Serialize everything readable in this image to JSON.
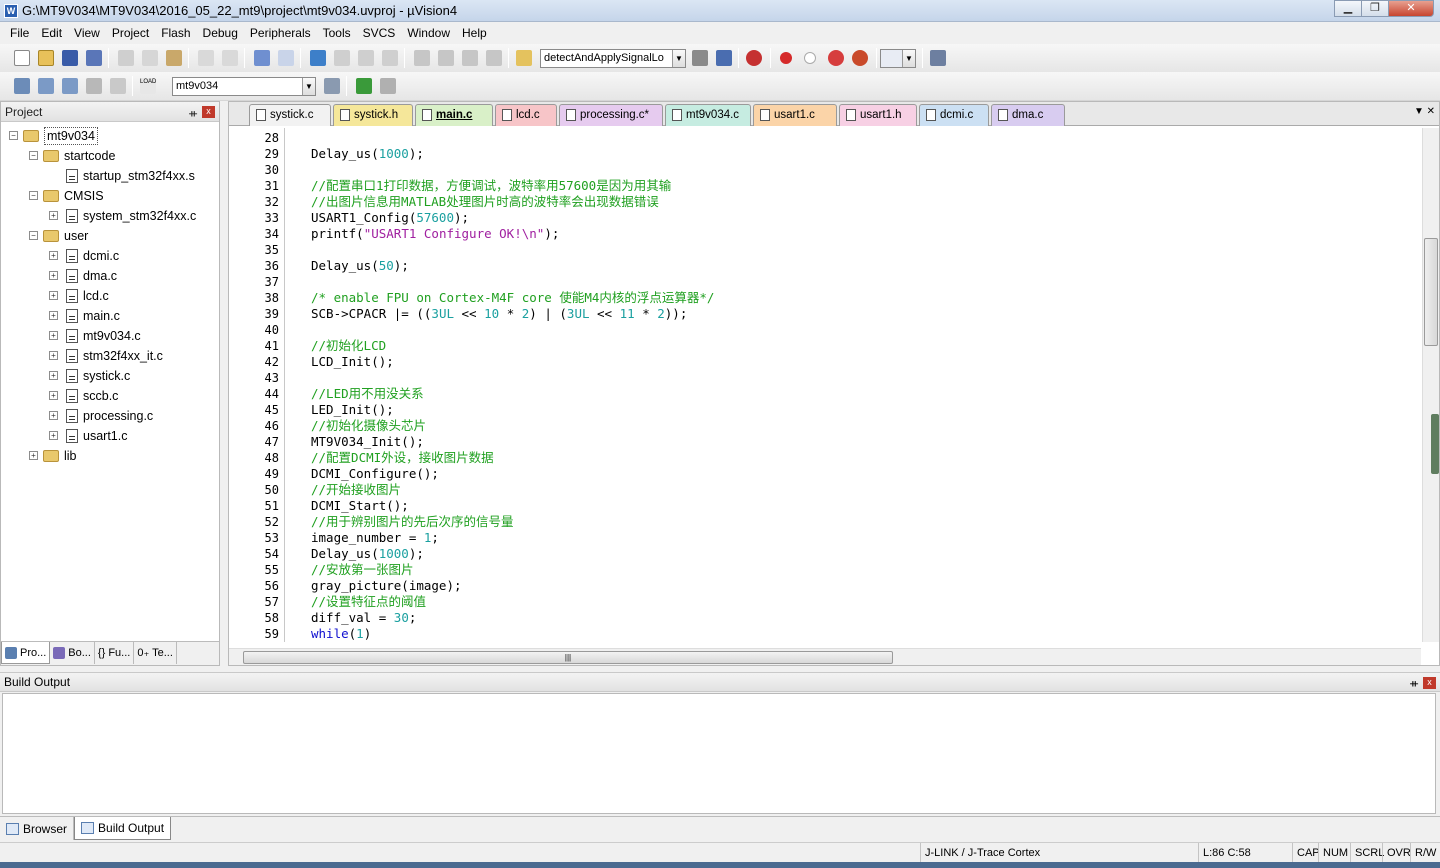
{
  "window": {
    "title": "G:\\MT9V034\\MT9V034\\2016_05_22_mt9\\project\\mt9v034.uvproj - µVision4",
    "app_icon": "W",
    "min": "▁",
    "max": "❐",
    "close": "✕"
  },
  "menu": [
    "File",
    "Edit",
    "View",
    "Project",
    "Flash",
    "Debug",
    "Peripherals",
    "Tools",
    "SVCS",
    "Window",
    "Help"
  ],
  "toolbar": {
    "find_combo": "detectAndApplySignalLo",
    "target_combo": "mt9v034",
    "load_label": "LOAD"
  },
  "project_panel": {
    "title": "Project",
    "pin": "ᚑ",
    "close": "x",
    "tree": [
      {
        "label": "mt9v034",
        "level": 0,
        "kind": "root",
        "exp": "−"
      },
      {
        "label": "startcode",
        "level": 1,
        "kind": "folder",
        "exp": "−"
      },
      {
        "label": "startup_stm32f4xx.s",
        "level": 2,
        "kind": "file",
        "exp": ""
      },
      {
        "label": "CMSIS",
        "level": 1,
        "kind": "folder",
        "exp": "−"
      },
      {
        "label": "system_stm32f4xx.c",
        "level": 2,
        "kind": "file",
        "exp": "+"
      },
      {
        "label": "user",
        "level": 1,
        "kind": "folder",
        "exp": "−"
      },
      {
        "label": "dcmi.c",
        "level": 2,
        "kind": "file",
        "exp": "+"
      },
      {
        "label": "dma.c",
        "level": 2,
        "kind": "file",
        "exp": "+"
      },
      {
        "label": "lcd.c",
        "level": 2,
        "kind": "file",
        "exp": "+"
      },
      {
        "label": "main.c",
        "level": 2,
        "kind": "file",
        "exp": "+"
      },
      {
        "label": "mt9v034.c",
        "level": 2,
        "kind": "file",
        "exp": "+"
      },
      {
        "label": "stm32f4xx_it.c",
        "level": 2,
        "kind": "file",
        "exp": "+"
      },
      {
        "label": "systick.c",
        "level": 2,
        "kind": "file",
        "exp": "+"
      },
      {
        "label": "sccb.c",
        "level": 2,
        "kind": "file",
        "exp": "+"
      },
      {
        "label": "processing.c",
        "level": 2,
        "kind": "file",
        "exp": "+"
      },
      {
        "label": "usart1.c",
        "level": 2,
        "kind": "file",
        "exp": "+"
      },
      {
        "label": "lib",
        "level": 1,
        "kind": "folder",
        "exp": "+"
      }
    ],
    "tabs": [
      "Pro...",
      "Bo...",
      "{} Fu...",
      "0₊ Te..."
    ]
  },
  "editor": {
    "tabs": [
      {
        "label": "systick.c",
        "color": "#f2f2f2"
      },
      {
        "label": "systick.h",
        "color": "#f5e79a"
      },
      {
        "label": "main.c",
        "color": "#d9f0c8",
        "active": true
      },
      {
        "label": "lcd.c",
        "color": "#f7c5c8"
      },
      {
        "label": "processing.c*",
        "color": "#e6cbef"
      },
      {
        "label": "mt9v034.c",
        "color": "#c6ece1"
      },
      {
        "label": "usart1.c",
        "color": "#fbd4a8"
      },
      {
        "label": "usart1.h",
        "color": "#f7d0e4"
      },
      {
        "label": "dcmi.c",
        "color": "#cce0f3"
      },
      {
        "label": "dma.c",
        "color": "#d8ccf0"
      }
    ],
    "tab_menu": "▼ ✕",
    "first_line": 28,
    "lines": [
      [],
      [
        {
          "t": "Delay_us("
        },
        {
          "t": "1000",
          "c": "num"
        },
        {
          "t": ");"
        }
      ],
      [],
      [
        {
          "t": "//配置串口1打印数据，方便调试，波特率用57600是因为用其输",
          "c": "cm"
        }
      ],
      [
        {
          "t": "//出图片信息用MATLAB处理图片时高的波特率会出现数据错误",
          "c": "cm"
        }
      ],
      [
        {
          "t": "USART1_Config("
        },
        {
          "t": "57600",
          "c": "num"
        },
        {
          "t": ");"
        }
      ],
      [
        {
          "t": "printf("
        },
        {
          "t": "\"USART1 Configure OK!\\n\"",
          "c": "str"
        },
        {
          "t": ");"
        }
      ],
      [],
      [
        {
          "t": "Delay_us("
        },
        {
          "t": "50",
          "c": "num"
        },
        {
          "t": ");"
        }
      ],
      [],
      [
        {
          "t": "/* enable FPU on Cortex-M4F core 使能M4内核的浮点运算器*/",
          "c": "cm"
        }
      ],
      [
        {
          "t": "SCB->CPACR |= (("
        },
        {
          "t": "3UL",
          "c": "num"
        },
        {
          "t": " << "
        },
        {
          "t": "10",
          "c": "num"
        },
        {
          "t": " * "
        },
        {
          "t": "2",
          "c": "num"
        },
        {
          "t": ") | ("
        },
        {
          "t": "3UL",
          "c": "num"
        },
        {
          "t": " << "
        },
        {
          "t": "11",
          "c": "num"
        },
        {
          "t": " * "
        },
        {
          "t": "2",
          "c": "num"
        },
        {
          "t": "));"
        }
      ],
      [],
      [
        {
          "t": "//初始化LCD",
          "c": "cm"
        }
      ],
      [
        {
          "t": "LCD_Init();"
        }
      ],
      [],
      [
        {
          "t": "//LED用不用没关系",
          "c": "cm"
        }
      ],
      [
        {
          "t": "LED_Init();"
        }
      ],
      [
        {
          "t": "//初始化摄像头芯片",
          "c": "cm"
        }
      ],
      [
        {
          "t": "MT9V034_Init();"
        }
      ],
      [
        {
          "t": "//配置DCMI外设，接收图片数据",
          "c": "cm"
        }
      ],
      [
        {
          "t": "DCMI_Configure();"
        }
      ],
      [
        {
          "t": "//开始接收图片",
          "c": "cm"
        }
      ],
      [
        {
          "t": "DCMI_Start();"
        }
      ],
      [
        {
          "t": "//用于辨别图片的先后次序的信号量",
          "c": "cm"
        }
      ],
      [
        {
          "t": "image_number = "
        },
        {
          "t": "1",
          "c": "num"
        },
        {
          "t": ";"
        }
      ],
      [
        {
          "t": "Delay_us("
        },
        {
          "t": "1000",
          "c": "num"
        },
        {
          "t": ");"
        }
      ],
      [
        {
          "t": "//安放第一张图片",
          "c": "cm"
        }
      ],
      [
        {
          "t": "gray_picture(image);"
        }
      ],
      [
        {
          "t": "//设置特征点的阈值",
          "c": "cm"
        }
      ],
      [
        {
          "t": "diff_val = "
        },
        {
          "t": "30",
          "c": "num"
        },
        {
          "t": ";"
        }
      ],
      [
        {
          "t": "while",
          "c": "kw"
        },
        {
          "t": "("
        },
        {
          "t": "1",
          "c": "num"
        },
        {
          "t": ")"
        }
      ]
    ]
  },
  "build_output": {
    "title": "Build Output",
    "pin": "ᚑ",
    "close": "x",
    "content": ""
  },
  "bottom_tabs": [
    "Browser",
    "Build Output"
  ],
  "statusbar": {
    "debugger": "J-LINK / J-Trace Cortex",
    "position": "L:86 C:58",
    "caps": "CAP",
    "num": "NUM",
    "scrl": "SCRL",
    "ovr": "OVR",
    "rw": "R/W"
  }
}
